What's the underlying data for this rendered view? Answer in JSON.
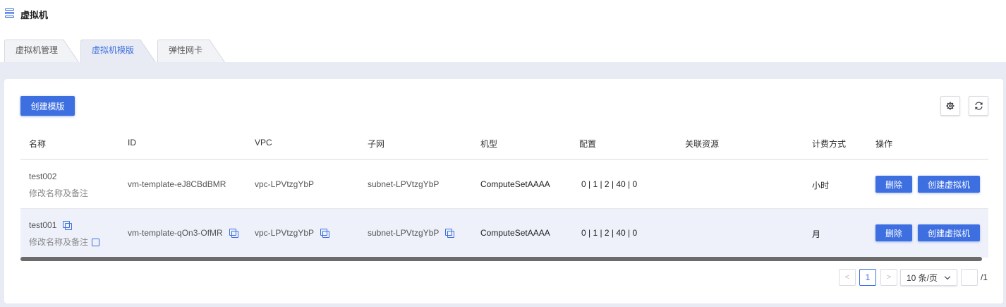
{
  "header": {
    "title": "虚拟机",
    "icon": "menu-icon"
  },
  "tabs": [
    {
      "label": "虚拟机管理",
      "active": false
    },
    {
      "label": "虚拟机模版",
      "active": true
    },
    {
      "label": "弹性网卡",
      "active": false
    }
  ],
  "toolbar": {
    "create_label": "创建模版",
    "settings_icon": "gear-icon",
    "refresh_icon": "refresh-icon"
  },
  "table": {
    "columns": [
      "名称",
      "ID",
      "VPC",
      "子网",
      "机型",
      "配置",
      "关联资源",
      "计费方式",
      "操作"
    ],
    "rows": [
      {
        "name": "test002",
        "remark": "修改名称及备注",
        "id": "vm-template-eJ8CBdBMR",
        "vpc": "vpc-LPVtzgYbP",
        "subnet": "subnet-LPVtzgYbP",
        "type": "ComputeSetAAAA",
        "config": "0 | 1 | 2 | 40 | 0",
        "related": "",
        "billing": "小时",
        "delete_label": "删除",
        "create_vm_label": "创建虚拟机"
      },
      {
        "name": "test001",
        "remark": "修改名称及备注",
        "id": "vm-template-qOn3-OfMR",
        "vpc": "vpc-LPVtzgYbP",
        "subnet": "subnet-LPVtzgYbP",
        "type": "ComputeSetAAAA",
        "config": "0 | 1 | 2 | 40 | 0",
        "related": "",
        "billing": "月",
        "delete_label": "删除",
        "create_vm_label": "创建虚拟机"
      }
    ]
  },
  "pagination": {
    "prev": "<",
    "current": "1",
    "next": ">",
    "page_size": "10 条/页",
    "jump_value": "",
    "total": "/1"
  },
  "colors": {
    "accent": "#3d6fe0",
    "content_bg": "#e8ebf3",
    "row_hover": "#eef1fa"
  }
}
